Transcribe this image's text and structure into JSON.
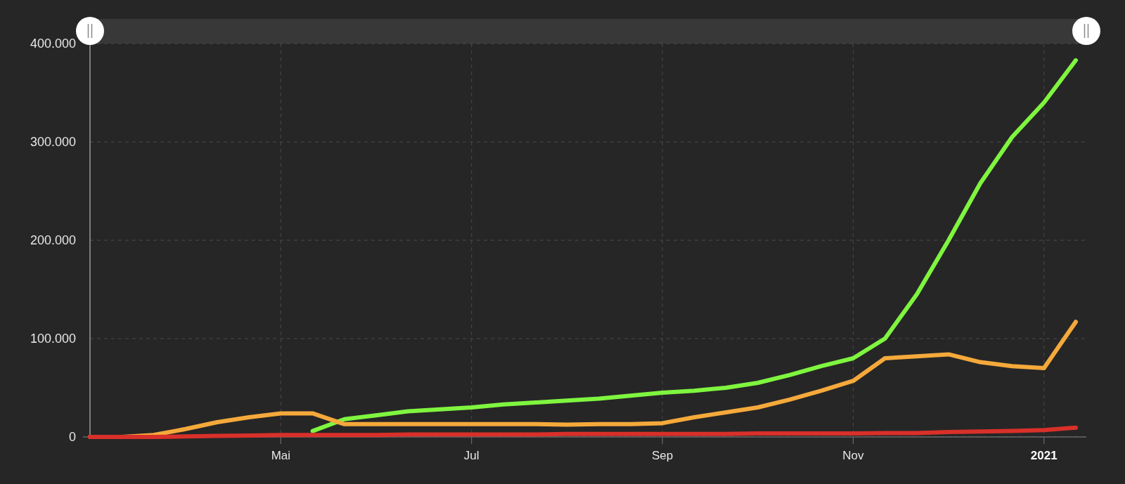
{
  "chart_data": {
    "type": "line",
    "grid": true,
    "categories": [
      null,
      null,
      null,
      null,
      null,
      null,
      "Mai",
      null,
      null,
      null,
      null,
      null,
      "Jul",
      null,
      null,
      null,
      null,
      null,
      "Sep",
      null,
      null,
      null,
      null,
      null,
      "Nov",
      null,
      null,
      null,
      null,
      null,
      "2021",
      null
    ],
    "ylim": [
      0,
      400000
    ],
    "yticks": [
      {
        "value": 0,
        "label": "0"
      },
      {
        "value": 100000,
        "label": "100.000"
      },
      {
        "value": 200000,
        "label": "200.000"
      },
      {
        "value": 300000,
        "label": "300.000"
      },
      {
        "value": 400000,
        "label": "400.000"
      }
    ],
    "series": [
      {
        "color": "#7ff53f",
        "values": [
          null,
          null,
          null,
          null,
          null,
          null,
          null,
          6000,
          18000,
          22000,
          26000,
          28000,
          30000,
          33000,
          35000,
          37000,
          39000,
          42000,
          45000,
          47000,
          50000,
          55000,
          63000,
          72000,
          80000,
          100000,
          145000,
          200000,
          258000,
          305000,
          340000,
          383000
        ]
      },
      {
        "color": "#f5a93b",
        "values": [
          0,
          0,
          2000,
          8000,
          15000,
          20000,
          24000,
          24000,
          13000,
          13000,
          13000,
          13000,
          13000,
          13000,
          13000,
          12500,
          13000,
          13000,
          14000,
          20000,
          25000,
          30000,
          38000,
          47000,
          57000,
          80000,
          82000,
          84000,
          76000,
          72000,
          70000,
          117000
        ]
      },
      {
        "color": "#d9302a",
        "values": [
          0,
          0,
          0,
          500,
          1000,
          1500,
          2000,
          2000,
          2000,
          2000,
          2500,
          2500,
          2500,
          2500,
          2500,
          3000,
          3000,
          3000,
          3000,
          3000,
          3000,
          3500,
          3500,
          3500,
          3500,
          4000,
          4000,
          5000,
          5500,
          6000,
          7000,
          9500
        ]
      }
    ]
  }
}
